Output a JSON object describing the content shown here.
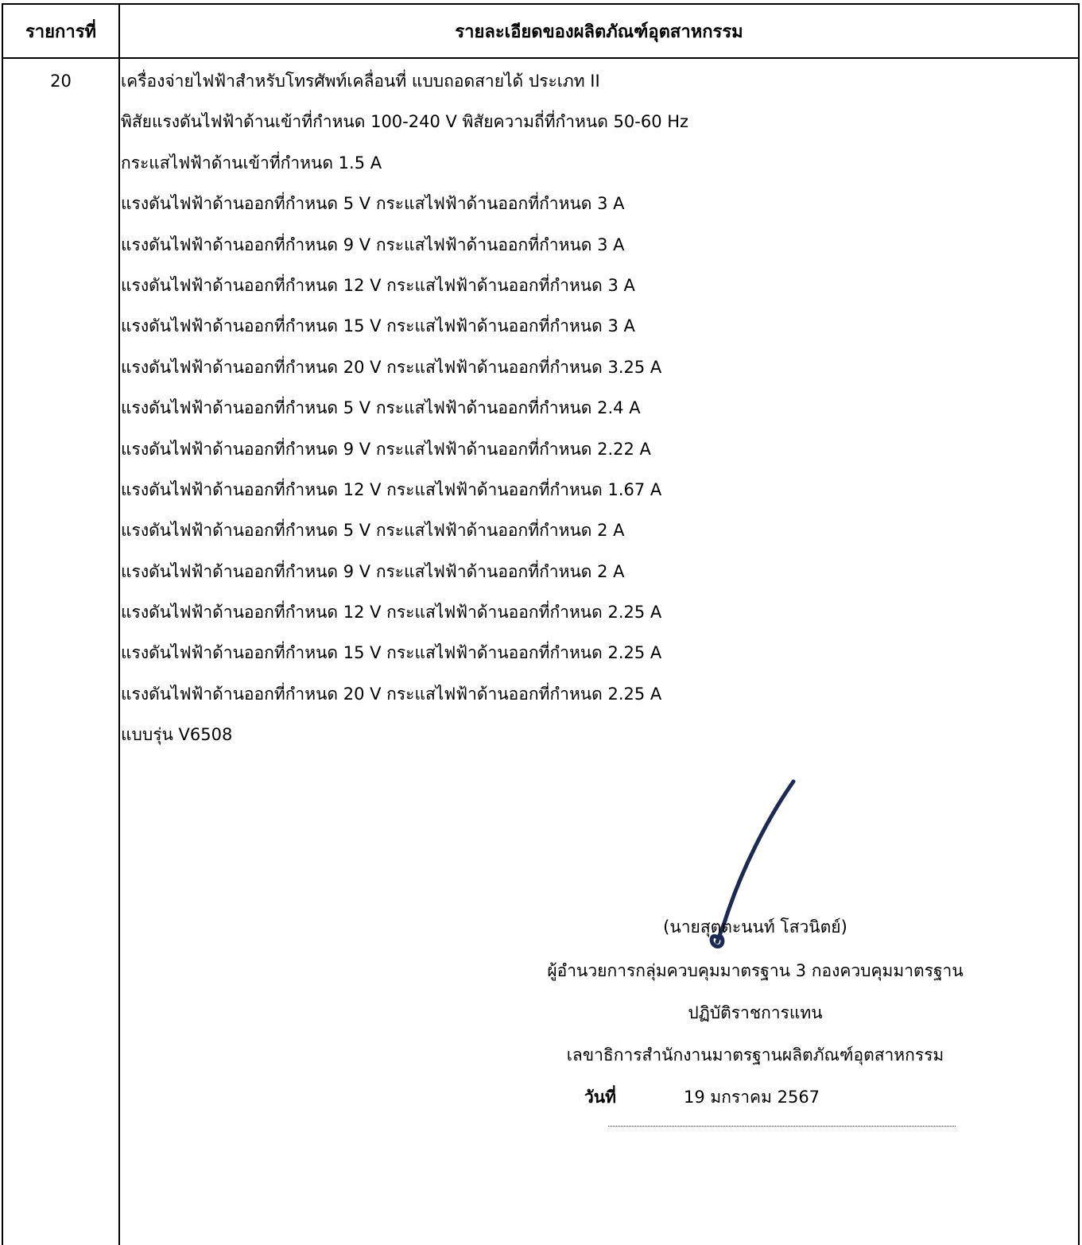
{
  "header": {
    "col_no": "รายการที่",
    "col_detail": "รายละเอียดของผลิตภัณฑ์อุตสาหกรรม"
  },
  "item": {
    "number": "20",
    "lines": [
      "เครื่องจ่ายไฟฟ้าสำหรับโทรศัพท์เคลื่อนที่ แบบถอดสายได้  ประเภท II",
      "พิสัยแรงดันไฟฟ้าด้านเข้าที่กำหนด 100-240 V พิสัยความถี่ที่กำหนด 50-60 Hz",
      "กระแสไฟฟ้าด้านเข้าที่กำหนด 1.5 A",
      "แรงดันไฟฟ้าด้านออกที่กำหนด 5 V กระแสไฟฟ้าด้านออกที่กำหนด 3 A",
      "แรงดันไฟฟ้าด้านออกที่กำหนด 9 V กระแสไฟฟ้าด้านออกที่กำหนด 3 A",
      "แรงดันไฟฟ้าด้านออกที่กำหนด 12 V กระแสไฟฟ้าด้านออกที่กำหนด 3 A",
      "แรงดันไฟฟ้าด้านออกที่กำหนด 15 V กระแสไฟฟ้าด้านออกที่กำหนด 3 A",
      "แรงดันไฟฟ้าด้านออกที่กำหนด 20 V กระแสไฟฟ้าด้านออกที่กำหนด 3.25 A",
      "แรงดันไฟฟ้าด้านออกที่กำหนด 5 V กระแสไฟฟ้าด้านออกที่กำหนด 2.4 A",
      "แรงดันไฟฟ้าด้านออกที่กำหนด 9 V กระแสไฟฟ้าด้านออกที่กำหนด 2.22 A",
      "แรงดันไฟฟ้าด้านออกที่กำหนด 12 V กระแสไฟฟ้าด้านออกที่กำหนด 1.67 A",
      "แรงดันไฟฟ้าด้านออกที่กำหนด 5 V กระแสไฟฟ้าด้านออกที่กำหนด 2 A",
      "แรงดันไฟฟ้าด้านออกที่กำหนด 9 V กระแสไฟฟ้าด้านออกที่กำหนด 2 A",
      "แรงดันไฟฟ้าด้านออกที่กำหนด 12 V กระแสไฟฟ้าด้านออกที่กำหนด 2.25 A",
      "แรงดันไฟฟ้าด้านออกที่กำหนด 15 V กระแสไฟฟ้าด้านออกที่กำหนด 2.25 A",
      "แรงดันไฟฟ้าด้านออกที่กำหนด 20 V กระแสไฟฟ้าด้านออกที่กำหนด 2.25 A",
      "แบบรุ่น V6508"
    ]
  },
  "signatory": {
    "name": "(นายสุตตะนนท์ โสวนิตย์)",
    "position_line1": "ผู้อำนวยการกลุ่มควบคุมมาตรฐาน 3 กองควบคุมมาตรฐาน",
    "position_line2": "ปฏิบัติราชการแทน",
    "position_line3": "เลขาธิการสำนักงานมาตรฐานผลิตภัณฑ์อุตสาหกรรม",
    "date_label": "วันที่",
    "date_value": "19 มกราคม 2567",
    "signature_color": "#1b2a55"
  }
}
